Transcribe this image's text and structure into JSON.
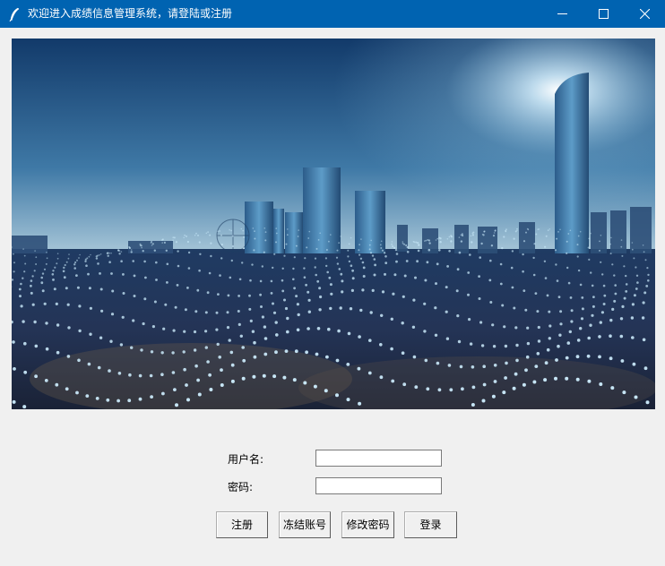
{
  "window": {
    "title": "欢迎进入成绩信息管理系统，请登陆或注册",
    "icons": {
      "app": "feather-icon",
      "minimize": "minimize-icon",
      "maximize": "maximize-icon",
      "close": "close-icon"
    }
  },
  "colors": {
    "titlebar": "#0063b1",
    "background": "#f0f0f0",
    "field_border": "#7a7a7a"
  },
  "form": {
    "username_label": "用户名:",
    "username_value": "",
    "password_label": "密码:",
    "password_value": ""
  },
  "buttons": {
    "register": "注册",
    "freeze": "冻结账号",
    "change_password": "修改密码",
    "login": "登录"
  }
}
